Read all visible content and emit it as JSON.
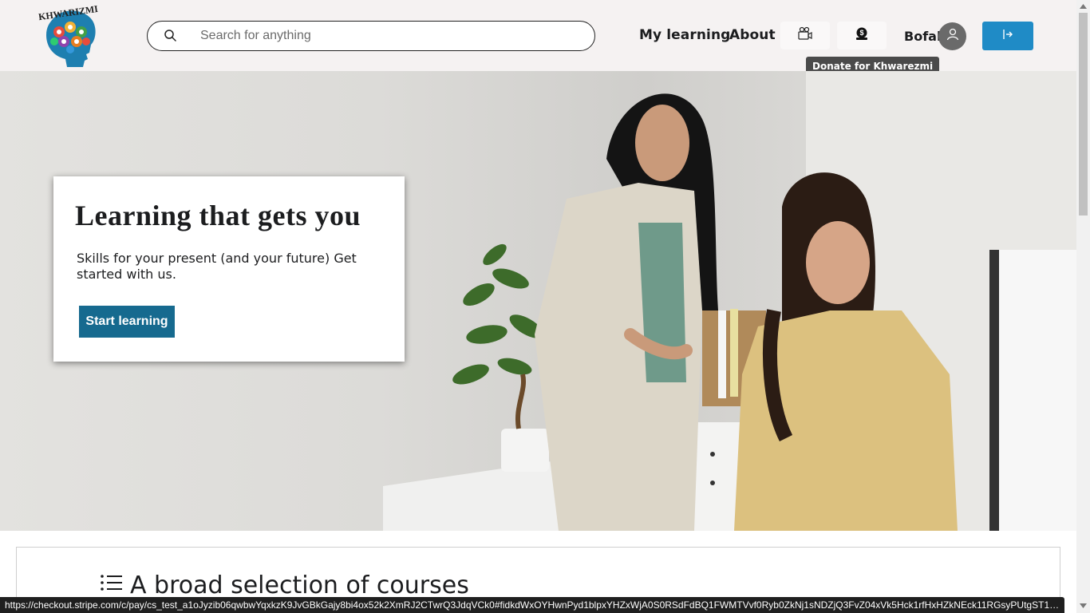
{
  "header": {
    "logo_text": "KHWARIZMI",
    "search_placeholder": "Search for anything",
    "search_value": "",
    "nav_my_learning": "My learning",
    "nav_about": "About",
    "tooltip_donate": "Donate for Khwarezmi",
    "user_name": "Bofal",
    "icons": {
      "search": "search-icon",
      "video": "video-camera-icon",
      "donate": "donate-icon",
      "avatar": "user-icon",
      "logout": "logout-icon"
    }
  },
  "hero": {
    "title": "Learning that gets you",
    "subtitle": "Skills for your present (and your future) Get started with us.",
    "cta_label": "Start learning"
  },
  "section": {
    "title": "A broad selection of courses"
  },
  "status_bar": {
    "url": "https://checkout.stripe.com/c/pay/cs_test_a1oJyzib06qwbwYqxkzK9JvGBkGajy8bi4ox52k2XmRJ2CTwrQ3JdqVCk0#fidkdWxOYHwnPyd1blpxYHZxWjA0S0RSdFdBQ1FWMTVvf0Ryb0ZkNj1sNDZjQ3FvZ04xVk5Hck1rfHxHZkNEck11RGsyPUtgST1OPFBcXDF..."
  },
  "colors": {
    "header_bg": "#f5f2f2",
    "primary_button": "#166a8f",
    "logout_button": "#1f8bc6",
    "text": "#1c1d1f"
  }
}
